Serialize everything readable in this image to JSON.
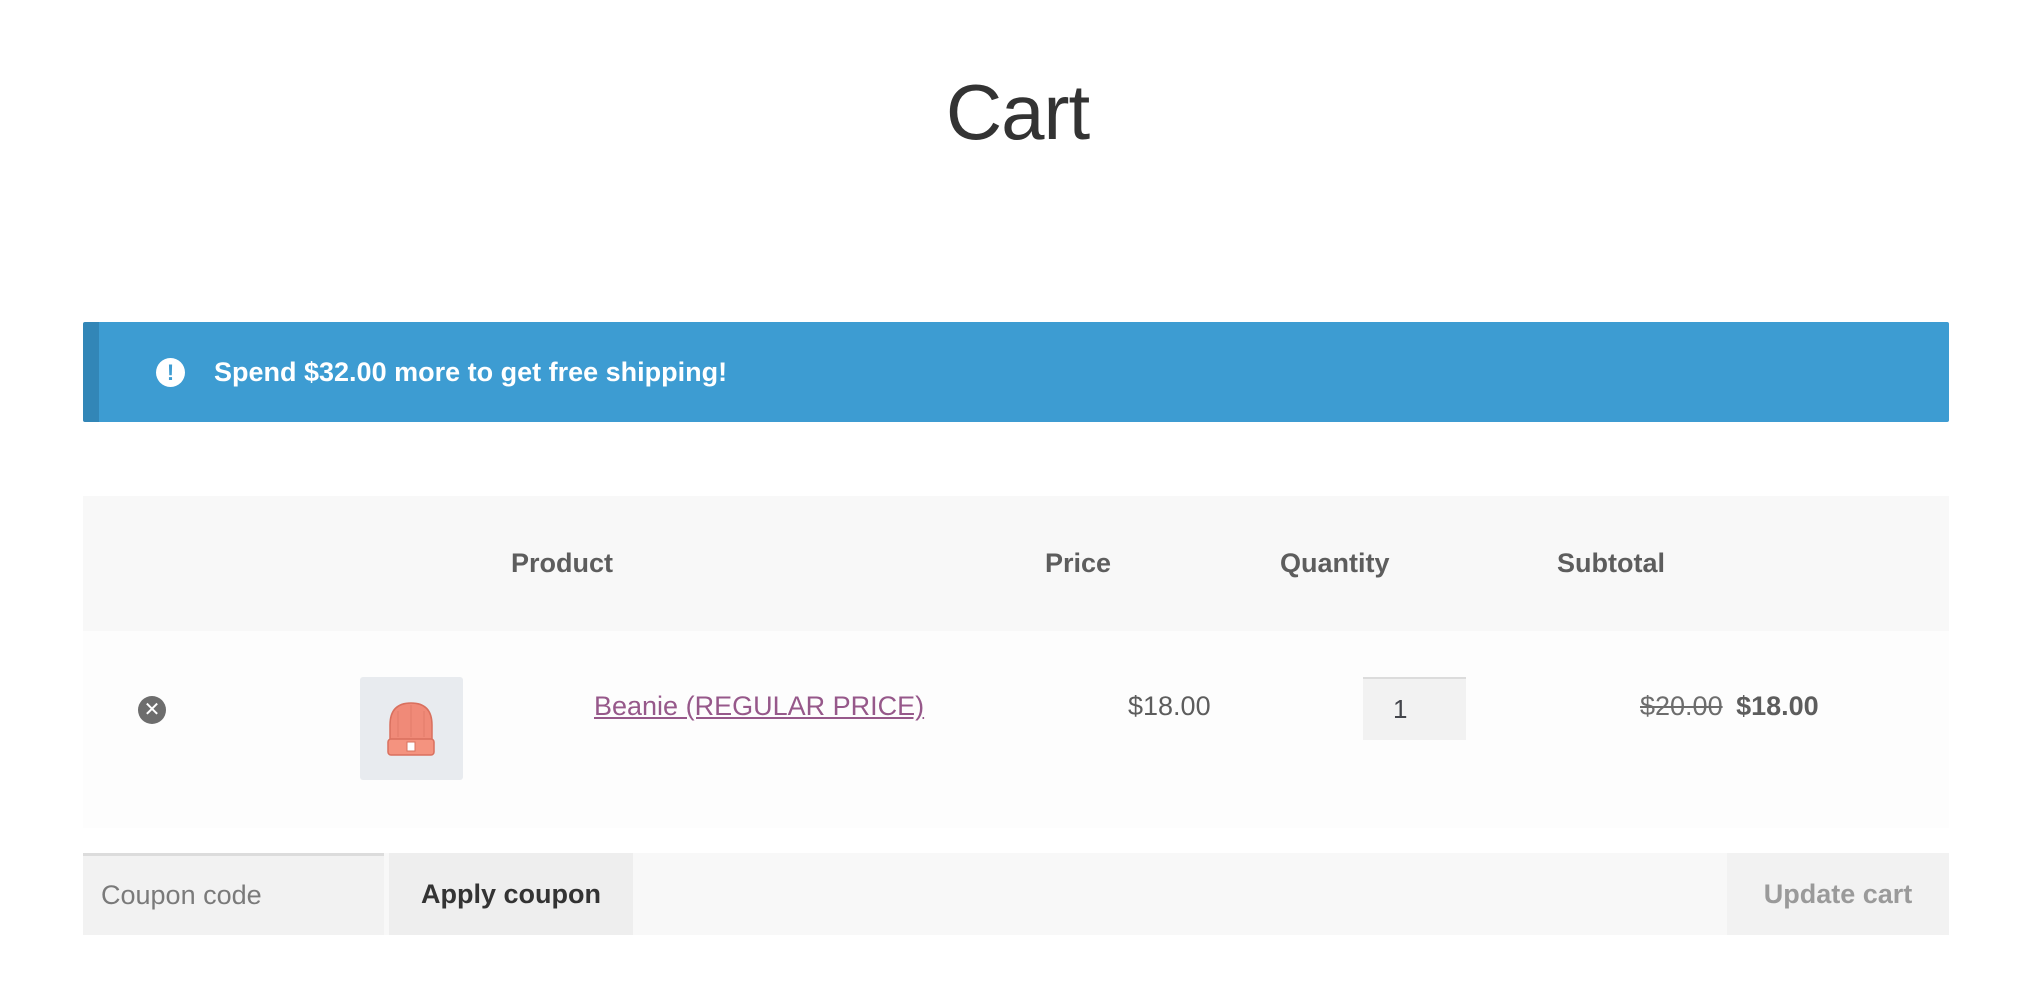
{
  "page": {
    "title": "Cart"
  },
  "notice": {
    "icon": "exclamation-circle-icon",
    "icon_glyph": "!",
    "message": "Spend $32.00 more to get free shipping!",
    "background_color": "#3d9cd2"
  },
  "table": {
    "headers": {
      "product": "Product",
      "price": "Price",
      "quantity": "Quantity",
      "subtotal": "Subtotal"
    },
    "rows": [
      {
        "remove_icon": "remove-circle-icon",
        "remove_glyph": "✕",
        "thumbnail_icon": "beanie-thumbnail",
        "product_name": "Beanie (REGULAR PRICE)",
        "price": "$18.00",
        "quantity": "1",
        "subtotal_original": "$20.00",
        "subtotal": "$18.00"
      }
    ]
  },
  "actions": {
    "coupon_placeholder": "Coupon code",
    "apply_coupon_label": "Apply coupon",
    "update_cart_label": "Update cart"
  },
  "colors": {
    "link": "#96588a",
    "notice_accent": "#3286b7"
  }
}
